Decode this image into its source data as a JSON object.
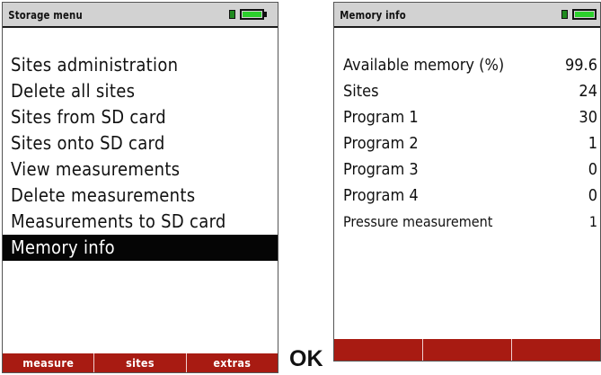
{
  "left_screen": {
    "title": "Storage menu",
    "battery_icon": "battery-full-icon",
    "menu_items": [
      "Sites administration",
      "Delete all sites",
      "Sites from SD card",
      "Sites onto SD card",
      "View measurements",
      "Delete measurements",
      "Measurements to SD card",
      "Memory info"
    ],
    "selected_item": "Memory info",
    "softkeys": [
      "measure",
      "sites",
      "extras"
    ]
  },
  "right_screen": {
    "title": "Memory info",
    "battery_icon": "battery-full-icon",
    "rows": [
      {
        "label": "Available memory (%)",
        "value": "99.6"
      },
      {
        "label": "Sites",
        "value": "24"
      },
      {
        "label": "Program 1",
        "value": "30"
      },
      {
        "label": "Program 2",
        "value": "1"
      },
      {
        "label": "Program 3",
        "value": "0"
      },
      {
        "label": "Program 4",
        "value": "0"
      },
      {
        "label": "Pressure measurement",
        "value": "1"
      }
    ],
    "softkeys": [
      "",
      "",
      ""
    ]
  },
  "ok_label": "OK",
  "colors": {
    "softkey_bar": "#a81b12",
    "title_bar": "#d2d2d2",
    "selection": "#050505",
    "battery_green": "#2cd02c"
  }
}
